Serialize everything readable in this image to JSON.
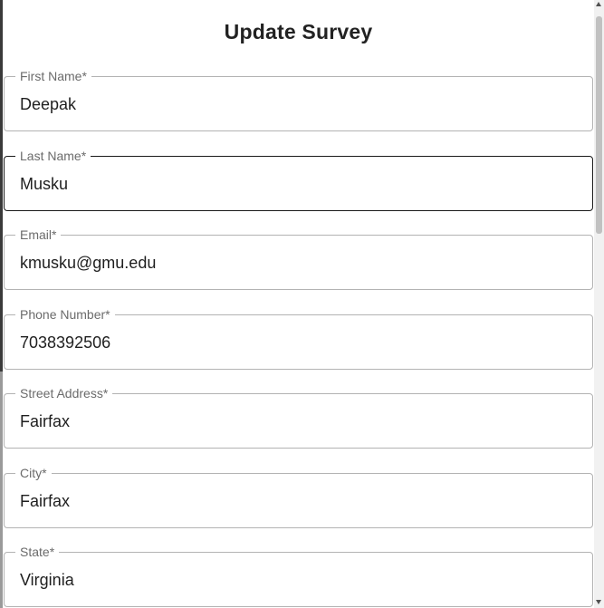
{
  "dialog": {
    "title": "Update Survey"
  },
  "form": {
    "fields": [
      {
        "label": "First Name*",
        "value": "Deepak"
      },
      {
        "label": "Last Name*",
        "value": "Musku"
      },
      {
        "label": "Email*",
        "value": "kmusku@gmu.edu"
      },
      {
        "label": "Phone Number*",
        "value": "7038392506"
      },
      {
        "label": "Street Address*",
        "value": "Fairfax"
      },
      {
        "label": "City*",
        "value": "Fairfax"
      },
      {
        "label": "State*",
        "value": "Virginia"
      }
    ],
    "focused_field": "Last Name*"
  },
  "colors": {
    "border": "#b3b3b3",
    "focused_border": "#1a1a1a",
    "label": "#6b6b6b",
    "text": "#1f1f1f"
  }
}
